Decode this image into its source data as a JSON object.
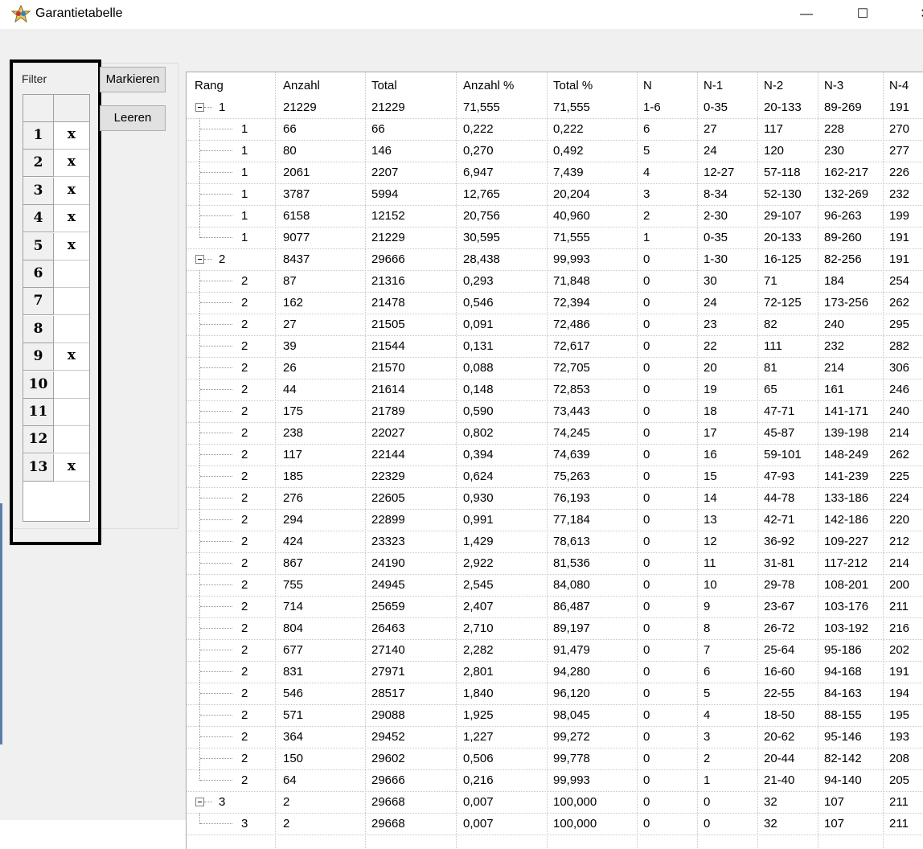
{
  "window": {
    "title": "Garantietabelle",
    "minimize": "—",
    "maximize": "☐",
    "close": "✕"
  },
  "filter": {
    "label": "Filter",
    "rows": [
      {
        "num": "1",
        "mark": "x"
      },
      {
        "num": "2",
        "mark": "x"
      },
      {
        "num": "3",
        "mark": "x"
      },
      {
        "num": "4",
        "mark": "x"
      },
      {
        "num": "5",
        "mark": "x"
      },
      {
        "num": "6",
        "mark": ""
      },
      {
        "num": "7",
        "mark": ""
      },
      {
        "num": "8",
        "mark": ""
      },
      {
        "num": "9",
        "mark": "x"
      },
      {
        "num": "10",
        "mark": ""
      },
      {
        "num": "11",
        "mark": ""
      },
      {
        "num": "12",
        "mark": ""
      },
      {
        "num": "13",
        "mark": "x"
      }
    ]
  },
  "buttons": {
    "mark": "Markieren",
    "clear": "Leeren"
  },
  "table": {
    "columns": [
      "Rang",
      "Anzahl",
      "Total",
      "Anzahl %",
      "Total %",
      "N",
      "N-1",
      "N-2",
      "N-3",
      "N-4"
    ],
    "rows": [
      {
        "level": 0,
        "expander": true,
        "cells": [
          "1",
          "21229",
          "21229",
          "71,555",
          "71,555",
          "1-6",
          "0-35",
          "20-133",
          "89-269",
          "191"
        ]
      },
      {
        "level": 1,
        "cells": [
          "1",
          "66",
          "66",
          "0,222",
          "0,222",
          "6",
          "27",
          "117",
          "228",
          "270"
        ]
      },
      {
        "level": 1,
        "cells": [
          "1",
          "80",
          "146",
          "0,270",
          "0,492",
          "5",
          "24",
          "120",
          "230",
          "277"
        ]
      },
      {
        "level": 1,
        "cells": [
          "1",
          "2061",
          "2207",
          "6,947",
          "7,439",
          "4",
          "12-27",
          "57-118",
          "162-217",
          "226"
        ]
      },
      {
        "level": 1,
        "cells": [
          "1",
          "3787",
          "5994",
          "12,765",
          "20,204",
          "3",
          "8-34",
          "52-130",
          "132-269",
          "232"
        ]
      },
      {
        "level": 1,
        "cells": [
          "1",
          "6158",
          "12152",
          "20,756",
          "40,960",
          "2",
          "2-30",
          "29-107",
          "96-263",
          "199"
        ]
      },
      {
        "level": 1,
        "last": true,
        "cells": [
          "1",
          "9077",
          "21229",
          "30,595",
          "71,555",
          "1",
          "0-35",
          "20-133",
          "89-260",
          "191"
        ]
      },
      {
        "level": 0,
        "expander": true,
        "cells": [
          "2",
          "8437",
          "29666",
          "28,438",
          "99,993",
          "0",
          "1-30",
          "16-125",
          "82-256",
          "191"
        ]
      },
      {
        "level": 1,
        "cells": [
          "2",
          "87",
          "21316",
          "0,293",
          "71,848",
          "0",
          "30",
          "71",
          "184",
          "254"
        ]
      },
      {
        "level": 1,
        "cells": [
          "2",
          "162",
          "21478",
          "0,546",
          "72,394",
          "0",
          "24",
          "72-125",
          "173-256",
          "262"
        ]
      },
      {
        "level": 1,
        "cells": [
          "2",
          "27",
          "21505",
          "0,091",
          "72,486",
          "0",
          "23",
          "82",
          "240",
          "295"
        ]
      },
      {
        "level": 1,
        "cells": [
          "2",
          "39",
          "21544",
          "0,131",
          "72,617",
          "0",
          "22",
          "111",
          "232",
          "282"
        ]
      },
      {
        "level": 1,
        "cells": [
          "2",
          "26",
          "21570",
          "0,088",
          "72,705",
          "0",
          "20",
          "81",
          "214",
          "306"
        ]
      },
      {
        "level": 1,
        "cells": [
          "2",
          "44",
          "21614",
          "0,148",
          "72,853",
          "0",
          "19",
          "65",
          "161",
          "246"
        ]
      },
      {
        "level": 1,
        "cells": [
          "2",
          "175",
          "21789",
          "0,590",
          "73,443",
          "0",
          "18",
          "47-71",
          "141-171",
          "240"
        ]
      },
      {
        "level": 1,
        "cells": [
          "2",
          "238",
          "22027",
          "0,802",
          "74,245",
          "0",
          "17",
          "45-87",
          "139-198",
          "214"
        ]
      },
      {
        "level": 1,
        "cells": [
          "2",
          "117",
          "22144",
          "0,394",
          "74,639",
          "0",
          "16",
          "59-101",
          "148-249",
          "262"
        ]
      },
      {
        "level": 1,
        "cells": [
          "2",
          "185",
          "22329",
          "0,624",
          "75,263",
          "0",
          "15",
          "47-93",
          "141-239",
          "225"
        ]
      },
      {
        "level": 1,
        "cells": [
          "2",
          "276",
          "22605",
          "0,930",
          "76,193",
          "0",
          "14",
          "44-78",
          "133-186",
          "224"
        ]
      },
      {
        "level": 1,
        "cells": [
          "2",
          "294",
          "22899",
          "0,991",
          "77,184",
          "0",
          "13",
          "42-71",
          "142-186",
          "220"
        ]
      },
      {
        "level": 1,
        "cells": [
          "2",
          "424",
          "23323",
          "1,429",
          "78,613",
          "0",
          "12",
          "36-92",
          "109-227",
          "212"
        ]
      },
      {
        "level": 1,
        "cells": [
          "2",
          "867",
          "24190",
          "2,922",
          "81,536",
          "0",
          "11",
          "31-81",
          "117-212",
          "214"
        ]
      },
      {
        "level": 1,
        "cells": [
          "2",
          "755",
          "24945",
          "2,545",
          "84,080",
          "0",
          "10",
          "29-78",
          "108-201",
          "200"
        ]
      },
      {
        "level": 1,
        "cells": [
          "2",
          "714",
          "25659",
          "2,407",
          "86,487",
          "0",
          "9",
          "23-67",
          "103-176",
          "211"
        ]
      },
      {
        "level": 1,
        "cells": [
          "2",
          "804",
          "26463",
          "2,710",
          "89,197",
          "0",
          "8",
          "26-72",
          "103-192",
          "216"
        ]
      },
      {
        "level": 1,
        "cells": [
          "2",
          "677",
          "27140",
          "2,282",
          "91,479",
          "0",
          "7",
          "25-64",
          "95-186",
          "202"
        ]
      },
      {
        "level": 1,
        "cells": [
          "2",
          "831",
          "27971",
          "2,801",
          "94,280",
          "0",
          "6",
          "16-60",
          "94-168",
          "191"
        ]
      },
      {
        "level": 1,
        "cells": [
          "2",
          "546",
          "28517",
          "1,840",
          "96,120",
          "0",
          "5",
          "22-55",
          "84-163",
          "194"
        ]
      },
      {
        "level": 1,
        "cells": [
          "2",
          "571",
          "29088",
          "1,925",
          "98,045",
          "0",
          "4",
          "18-50",
          "88-155",
          "195"
        ]
      },
      {
        "level": 1,
        "cells": [
          "2",
          "364",
          "29452",
          "1,227",
          "99,272",
          "0",
          "3",
          "20-62",
          "95-146",
          "193"
        ]
      },
      {
        "level": 1,
        "cells": [
          "2",
          "150",
          "29602",
          "0,506",
          "99,778",
          "0",
          "2",
          "20-44",
          "82-142",
          "208"
        ]
      },
      {
        "level": 1,
        "last": true,
        "cells": [
          "2",
          "64",
          "29666",
          "0,216",
          "99,993",
          "0",
          "1",
          "21-40",
          "94-140",
          "205"
        ]
      },
      {
        "level": 0,
        "expander": true,
        "last": true,
        "cells": [
          "3",
          "2",
          "29668",
          "0,007",
          "100,000",
          "0",
          "0",
          "32",
          "107",
          "211"
        ]
      },
      {
        "level": 1,
        "last": true,
        "cells": [
          "3",
          "2",
          "29668",
          "0,007",
          "100,000",
          "0",
          "0",
          "32",
          "107",
          "211"
        ]
      }
    ]
  }
}
